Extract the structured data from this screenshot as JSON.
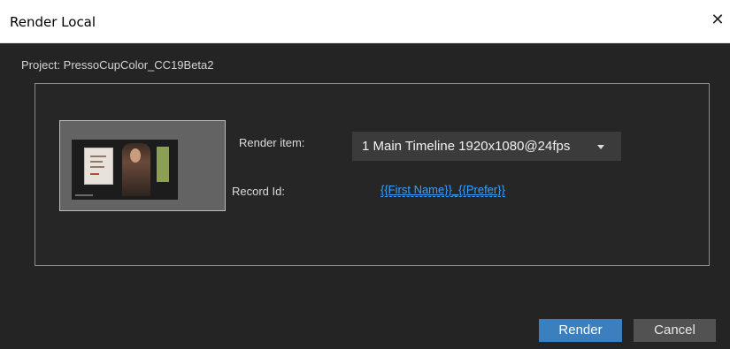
{
  "window": {
    "title": "Render Local",
    "close_icon": "close-icon"
  },
  "project": {
    "label": "Project: PressoCupColor_CC19Beta2"
  },
  "form": {
    "render_item_label": "Render item:",
    "render_item_value": "1 Main Timeline 1920x1080@24fps",
    "record_id_label": "Record Id:",
    "record_id_value": "{{First Name}}_{{Prefer}}"
  },
  "buttons": {
    "render": "Render",
    "cancel": "Cancel"
  },
  "colors": {
    "accent": "#3b7fbf",
    "link": "#3aa0ff",
    "background": "#242424"
  }
}
